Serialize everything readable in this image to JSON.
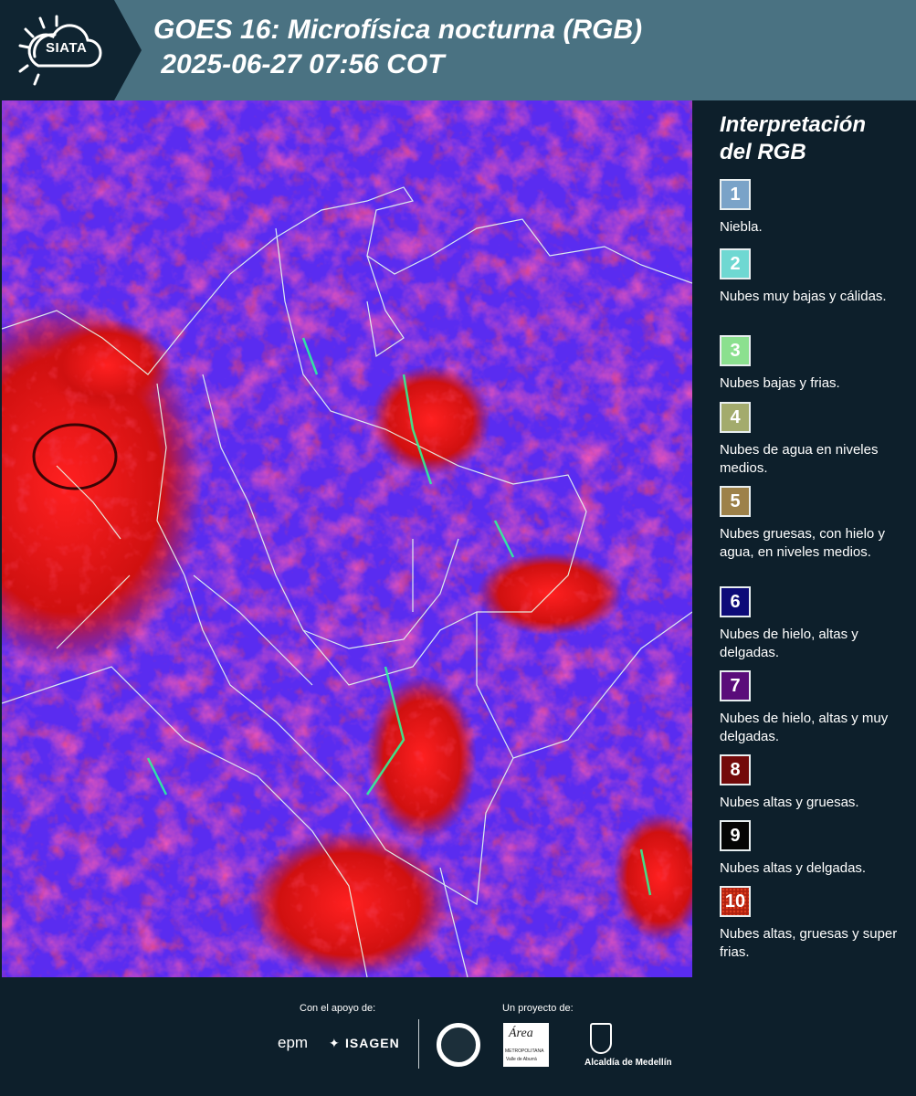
{
  "header": {
    "logo_text": "SIATA",
    "title": "GOES 16: Microfísica nocturna (RGB)\n 2025-06-27 07:56 COT"
  },
  "legend": {
    "title": "Interpretación\ndel RGB",
    "items": [
      {
        "num": "1",
        "color": "#7aa3c8",
        "label": "Niebla."
      },
      {
        "num": "2",
        "color": "#6fd8d2",
        "label": "Nubes muy bajas y cálidas."
      },
      {
        "num": "3",
        "color": "#8be08f",
        "label": "Nubes bajas y frias."
      },
      {
        "num": "4",
        "color": "#a3ab6d",
        "label": "Nubes de agua en niveles medios."
      },
      {
        "num": "5",
        "color": "#9d8149",
        "label": "Nubes gruesas, con hielo y agua, en niveles medios."
      },
      {
        "num": "6",
        "color": "#0d0b78",
        "label": "Nubes de hielo, altas y delgadas."
      },
      {
        "num": "7",
        "color": "#5a0c7a",
        "label": "Nubes de hielo, altas y muy delgadas."
      },
      {
        "num": "8",
        "color": "#730a0a",
        "label": "Nubes altas y gruesas."
      },
      {
        "num": "9",
        "color": "#050505",
        "label": "Nubes altas y delgadas."
      },
      {
        "num": "10",
        "color": "#b0200f",
        "label": "Nubes altas, gruesas y super frias."
      }
    ]
  },
  "footer": {
    "support_label": "Con el apoyo de:",
    "project_label": "Un proyecto de:",
    "epm": "epm",
    "isagen": "ISAGEN",
    "area_line1": "Área",
    "area_line2": "METROPOLITANA",
    "area_line3": "Valle de Aburrá",
    "alcaldia": "Alcaldía de Medellín"
  }
}
